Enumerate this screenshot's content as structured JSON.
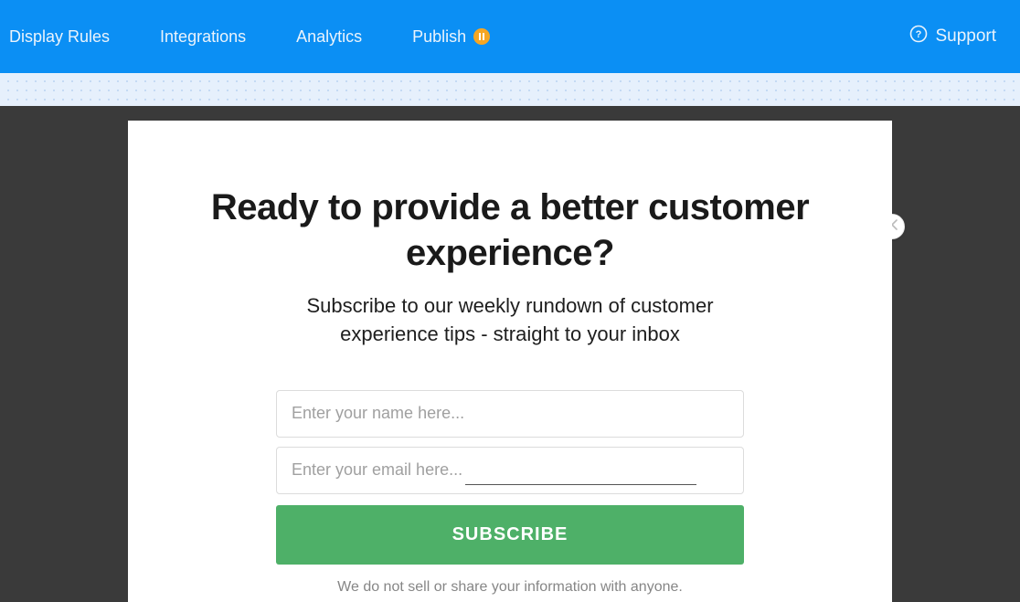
{
  "nav": {
    "items": [
      {
        "label": "Display Rules"
      },
      {
        "label": "Integrations"
      },
      {
        "label": "Analytics"
      },
      {
        "label": "Publish",
        "badge": "pause"
      }
    ],
    "support": "Support"
  },
  "modal": {
    "heading": "Ready to provide a better customer experience?",
    "subtitle": "Subscribe to our weekly rundown of customer experience tips - straight to your inbox",
    "name_placeholder": "Enter your name here...",
    "email_placeholder": "Enter your email here...",
    "name_value": "",
    "email_value": "",
    "submit_label": "SUBSCRIBE",
    "privacy_text": "We do not sell or share your information with anyone."
  },
  "colors": {
    "nav_bg": "#0b8ff4",
    "accent": "#4eb068",
    "badge": "#f5a623"
  }
}
